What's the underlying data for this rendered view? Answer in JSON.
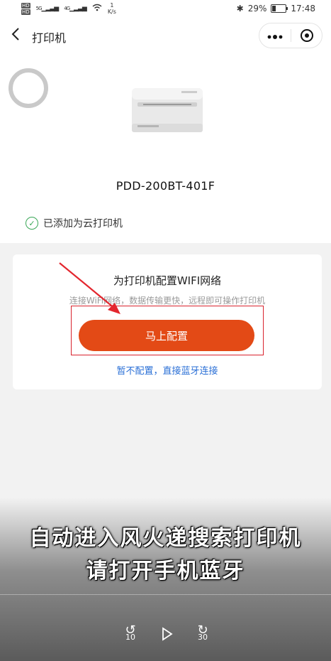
{
  "status_bar": {
    "hd1": "HD",
    "hd2": "HD",
    "net1": "5G",
    "net2": "4G",
    "speed_value": "1",
    "speed_unit": "K/s",
    "battery": "29%",
    "time": "17:48"
  },
  "nav": {
    "title": "打印机",
    "more_icon": "ellipsis-icon",
    "close_icon": "target-icon"
  },
  "printer": {
    "model": "PDD-200BT-401F",
    "added_label": "已添加为云打印机"
  },
  "wifi_card": {
    "title": "为打印机配置WIFI网络",
    "subtitle": "连接WiFi网络，数据传输更快，远程即可操作打印机",
    "configure_button": "马上配置",
    "bluetooth_link": "暂不配置，直接蓝牙连接"
  },
  "video_overlay": {
    "caption_line1": "自动进入风火递搜索打印机",
    "caption_line2": "请打开手机蓝牙",
    "rewind_seconds": "10",
    "forward_seconds": "30"
  },
  "colors": {
    "accent": "#e34a16",
    "link": "#2a6fd6",
    "success": "#3aa757",
    "highlight_box": "#d9232d",
    "annotation_arrow": "#e3262e"
  }
}
